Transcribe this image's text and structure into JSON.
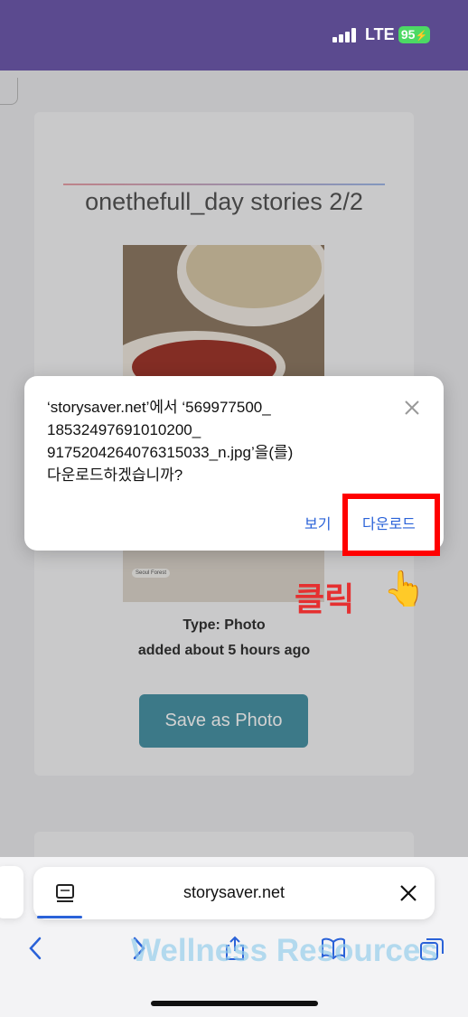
{
  "status_bar": {
    "network": "LTE",
    "battery": "95"
  },
  "page": {
    "story_title": "onethefull_day stories 2/2",
    "type_label": "Type: Photo",
    "added_label": "added about 5 hours ago",
    "save_button": "Save as Photo",
    "photo_tag": "Seoul Forest"
  },
  "dialog": {
    "message_line1": "‘storysaver.net’에서 ‘569977500_",
    "message_line2": "18532497691010200_",
    "message_line3": "9175204264076315033_n.jpg’을(를)",
    "message_line4": "다운로드하겠습니까?",
    "view_button": "보기",
    "download_button": "다운로드"
  },
  "annotation": {
    "click_label": "클릭",
    "hand": "👆"
  },
  "browser": {
    "url": "storysaver.net"
  },
  "watermark": "Wellness Resources",
  "colors": {
    "status_bar": "#5b4a8f",
    "accent": "#2a62d8",
    "highlight": "#ff0000",
    "save_button": "#4a94a6"
  }
}
